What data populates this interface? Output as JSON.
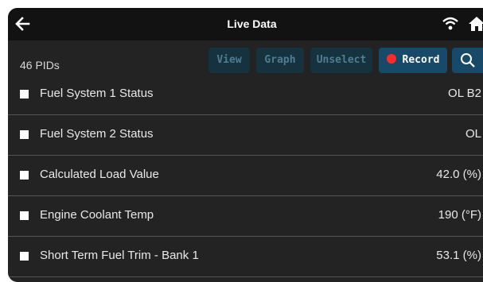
{
  "header": {
    "title": "Live Data"
  },
  "pid_count": "46 PIDs",
  "toolbar": {
    "view_label": "View",
    "graph_label": "Graph",
    "unselect_label": "Unselect",
    "record_label": "Record"
  },
  "rows": [
    {
      "label": "Fuel System 1 Status",
      "value": "OL B2"
    },
    {
      "label": "Fuel System 2 Status",
      "value": "OL"
    },
    {
      "label": "Calculated Load Value",
      "value": "42.0 (%)"
    },
    {
      "label": "Engine Coolant Temp",
      "value": "190 (°F)"
    },
    {
      "label": "Short Term Fuel Trim - Bank 1",
      "value": "53.1 (%)"
    }
  ],
  "icons": {
    "back": "arrow-left-icon",
    "wifi": "wifi-icon",
    "home": "home-icon",
    "search": "search-icon"
  },
  "colors": {
    "record_dot": "#ff2a2a",
    "button_bg": "#16323f",
    "active_button_bg": "#174a68"
  }
}
